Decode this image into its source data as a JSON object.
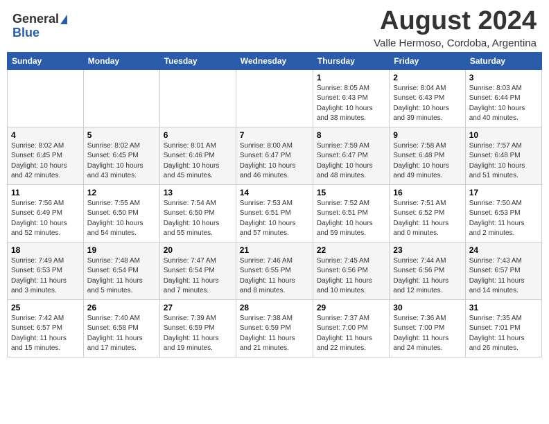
{
  "header": {
    "logo_general": "General",
    "logo_blue": "Blue",
    "month_title": "August 2024",
    "location": "Valle Hermoso, Cordoba, Argentina"
  },
  "days_of_week": [
    "Sunday",
    "Monday",
    "Tuesday",
    "Wednesday",
    "Thursday",
    "Friday",
    "Saturday"
  ],
  "weeks": [
    [
      {
        "day": "",
        "info": ""
      },
      {
        "day": "",
        "info": ""
      },
      {
        "day": "",
        "info": ""
      },
      {
        "day": "",
        "info": ""
      },
      {
        "day": "1",
        "info": "Sunrise: 8:05 AM\nSunset: 6:43 PM\nDaylight: 10 hours\nand 38 minutes."
      },
      {
        "day": "2",
        "info": "Sunrise: 8:04 AM\nSunset: 6:43 PM\nDaylight: 10 hours\nand 39 minutes."
      },
      {
        "day": "3",
        "info": "Sunrise: 8:03 AM\nSunset: 6:44 PM\nDaylight: 10 hours\nand 40 minutes."
      }
    ],
    [
      {
        "day": "4",
        "info": "Sunrise: 8:02 AM\nSunset: 6:45 PM\nDaylight: 10 hours\nand 42 minutes."
      },
      {
        "day": "5",
        "info": "Sunrise: 8:02 AM\nSunset: 6:45 PM\nDaylight: 10 hours\nand 43 minutes."
      },
      {
        "day": "6",
        "info": "Sunrise: 8:01 AM\nSunset: 6:46 PM\nDaylight: 10 hours\nand 45 minutes."
      },
      {
        "day": "7",
        "info": "Sunrise: 8:00 AM\nSunset: 6:47 PM\nDaylight: 10 hours\nand 46 minutes."
      },
      {
        "day": "8",
        "info": "Sunrise: 7:59 AM\nSunset: 6:47 PM\nDaylight: 10 hours\nand 48 minutes."
      },
      {
        "day": "9",
        "info": "Sunrise: 7:58 AM\nSunset: 6:48 PM\nDaylight: 10 hours\nand 49 minutes."
      },
      {
        "day": "10",
        "info": "Sunrise: 7:57 AM\nSunset: 6:48 PM\nDaylight: 10 hours\nand 51 minutes."
      }
    ],
    [
      {
        "day": "11",
        "info": "Sunrise: 7:56 AM\nSunset: 6:49 PM\nDaylight: 10 hours\nand 52 minutes."
      },
      {
        "day": "12",
        "info": "Sunrise: 7:55 AM\nSunset: 6:50 PM\nDaylight: 10 hours\nand 54 minutes."
      },
      {
        "day": "13",
        "info": "Sunrise: 7:54 AM\nSunset: 6:50 PM\nDaylight: 10 hours\nand 55 minutes."
      },
      {
        "day": "14",
        "info": "Sunrise: 7:53 AM\nSunset: 6:51 PM\nDaylight: 10 hours\nand 57 minutes."
      },
      {
        "day": "15",
        "info": "Sunrise: 7:52 AM\nSunset: 6:51 PM\nDaylight: 10 hours\nand 59 minutes."
      },
      {
        "day": "16",
        "info": "Sunrise: 7:51 AM\nSunset: 6:52 PM\nDaylight: 11 hours\nand 0 minutes."
      },
      {
        "day": "17",
        "info": "Sunrise: 7:50 AM\nSunset: 6:53 PM\nDaylight: 11 hours\nand 2 minutes."
      }
    ],
    [
      {
        "day": "18",
        "info": "Sunrise: 7:49 AM\nSunset: 6:53 PM\nDaylight: 11 hours\nand 3 minutes."
      },
      {
        "day": "19",
        "info": "Sunrise: 7:48 AM\nSunset: 6:54 PM\nDaylight: 11 hours\nand 5 minutes."
      },
      {
        "day": "20",
        "info": "Sunrise: 7:47 AM\nSunset: 6:54 PM\nDaylight: 11 hours\nand 7 minutes."
      },
      {
        "day": "21",
        "info": "Sunrise: 7:46 AM\nSunset: 6:55 PM\nDaylight: 11 hours\nand 8 minutes."
      },
      {
        "day": "22",
        "info": "Sunrise: 7:45 AM\nSunset: 6:56 PM\nDaylight: 11 hours\nand 10 minutes."
      },
      {
        "day": "23",
        "info": "Sunrise: 7:44 AM\nSunset: 6:56 PM\nDaylight: 11 hours\nand 12 minutes."
      },
      {
        "day": "24",
        "info": "Sunrise: 7:43 AM\nSunset: 6:57 PM\nDaylight: 11 hours\nand 14 minutes."
      }
    ],
    [
      {
        "day": "25",
        "info": "Sunrise: 7:42 AM\nSunset: 6:57 PM\nDaylight: 11 hours\nand 15 minutes."
      },
      {
        "day": "26",
        "info": "Sunrise: 7:40 AM\nSunset: 6:58 PM\nDaylight: 11 hours\nand 17 minutes."
      },
      {
        "day": "27",
        "info": "Sunrise: 7:39 AM\nSunset: 6:59 PM\nDaylight: 11 hours\nand 19 minutes."
      },
      {
        "day": "28",
        "info": "Sunrise: 7:38 AM\nSunset: 6:59 PM\nDaylight: 11 hours\nand 21 minutes."
      },
      {
        "day": "29",
        "info": "Sunrise: 7:37 AM\nSunset: 7:00 PM\nDaylight: 11 hours\nand 22 minutes."
      },
      {
        "day": "30",
        "info": "Sunrise: 7:36 AM\nSunset: 7:00 PM\nDaylight: 11 hours\nand 24 minutes."
      },
      {
        "day": "31",
        "info": "Sunrise: 7:35 AM\nSunset: 7:01 PM\nDaylight: 11 hours\nand 26 minutes."
      }
    ]
  ]
}
